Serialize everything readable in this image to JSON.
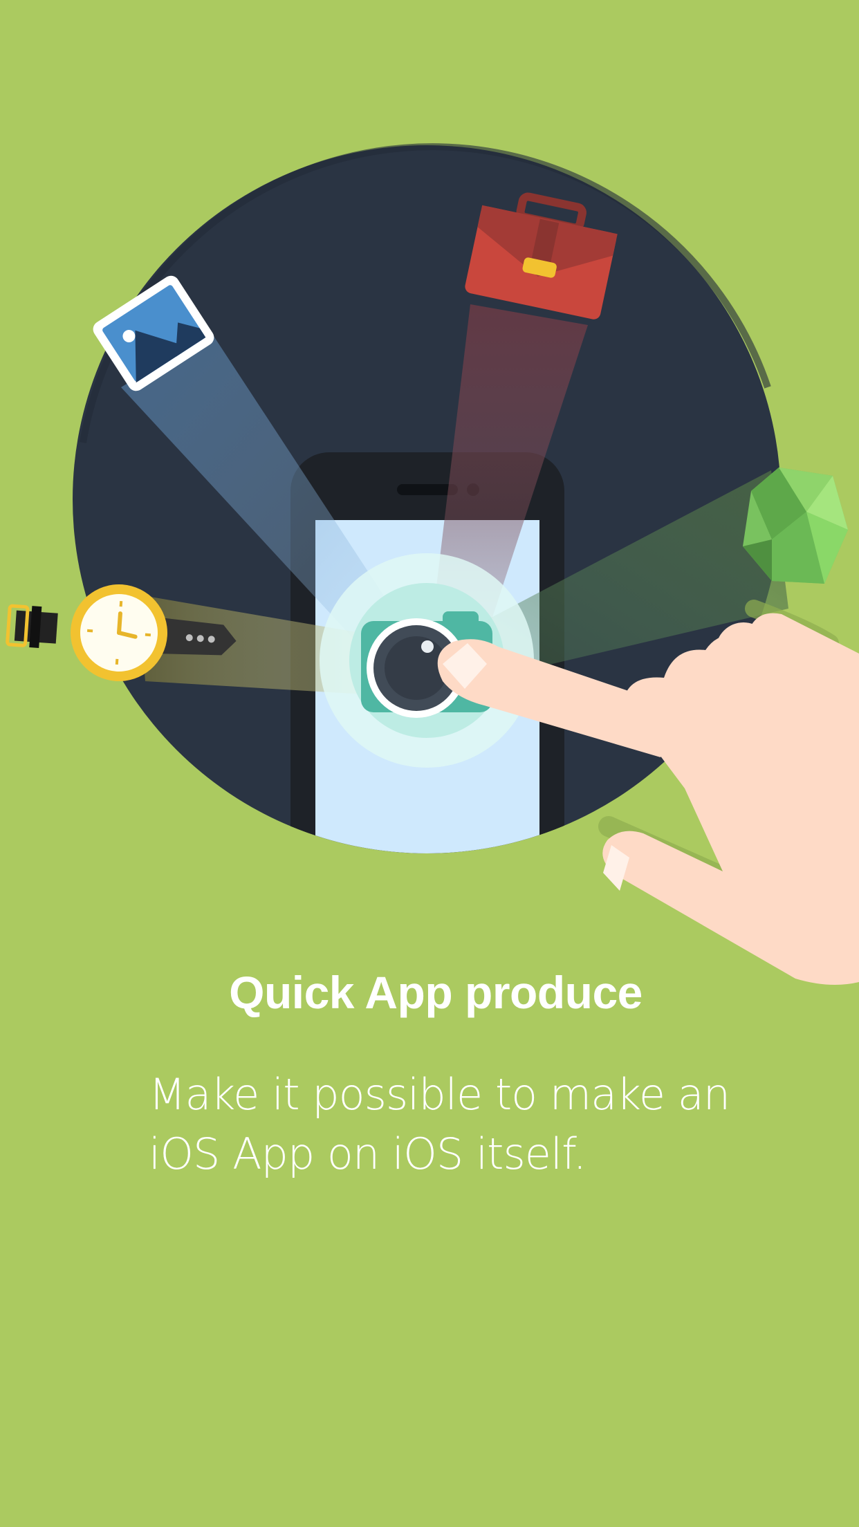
{
  "screen": {
    "background_color": "#abca60",
    "title": "Quick App produce",
    "description_lines": [
      "Make it possible to make an",
      "iOS App on iOS itself."
    ]
  },
  "illustration": {
    "icons": [
      "picture-icon",
      "briefcase-icon",
      "gem-icon",
      "watch-icon",
      "camera-icon",
      "smartphone",
      "pointing-hand"
    ],
    "colors": {
      "disc": "#2a3443",
      "phone_body": "#1e2228",
      "phone_screen": "#cfe9fd",
      "camera_teal": "#4fb7a3",
      "briefcase_red": "#c9473d",
      "picture_blue": "#4a8fcd",
      "gem_green": "#79c25f",
      "watch_yellow": "#f2c230",
      "hand_skin": "#fedac6"
    }
  }
}
